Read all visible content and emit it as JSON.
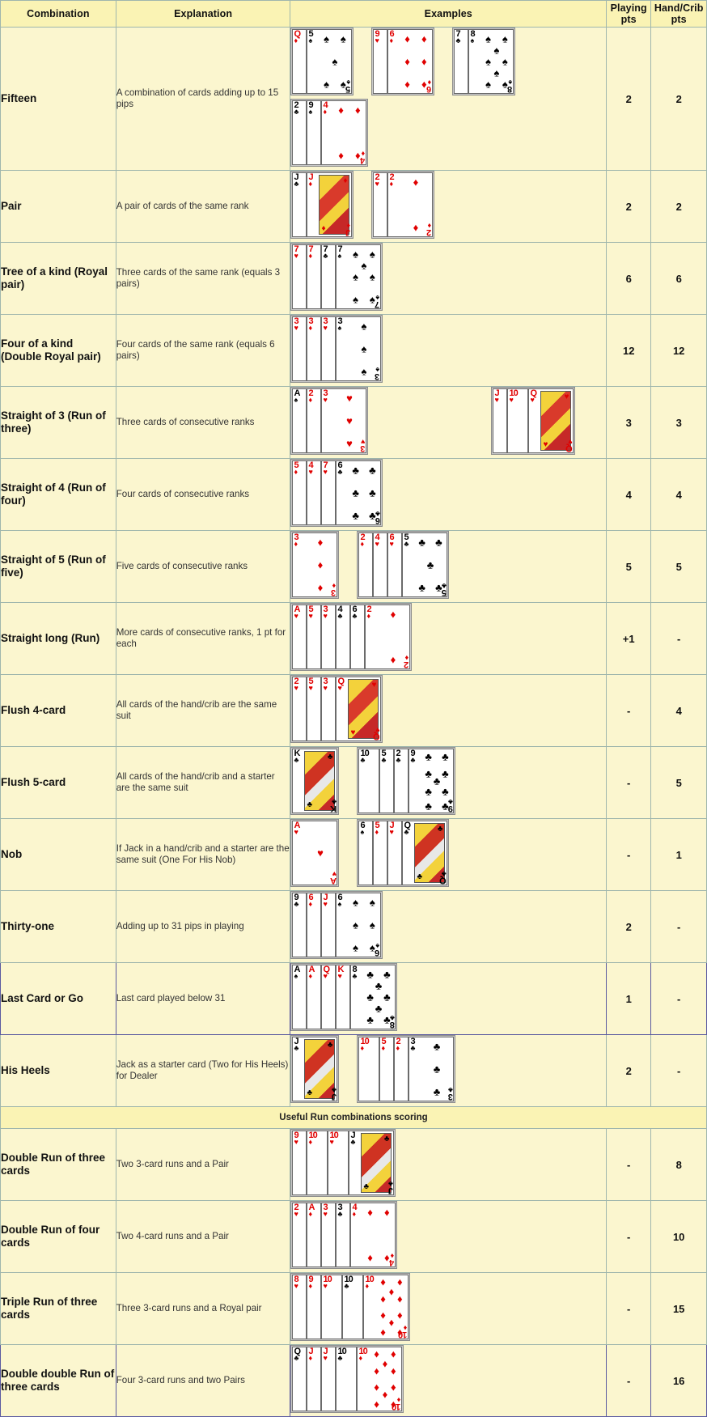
{
  "table": {
    "columns": [
      "Combination",
      "Explanation",
      "Examples",
      "Playing pts",
      "Hand/Crib pts"
    ],
    "headers": {
      "combination": "Combination",
      "explanation": "Explanation",
      "examples": "Examples",
      "playing_line1": "Playing",
      "playing_line2": "pts",
      "hand_line1": "Hand/Crib",
      "hand_line2": "pts"
    },
    "section_label": "Useful Run combinations scoring",
    "rows": [
      {
        "combination": "Fifteen",
        "explanation": "A combination of cards adding up to 15 pips",
        "playing_pts": "2",
        "hand_pts": "2",
        "hands": [
          {
            "cards": [
              {
                "rank": "Q",
                "suit": "diamonds",
                "color": "red",
                "face": true
              },
              {
                "rank": "5",
                "suit": "spades",
                "color": "black",
                "full": true
              }
            ]
          },
          {
            "cards": [
              {
                "rank": "9",
                "suit": "hearts",
                "color": "red"
              },
              {
                "rank": "6",
                "suit": "diamonds",
                "color": "red",
                "full": true
              }
            ]
          },
          {
            "cards": [
              {
                "rank": "7",
                "suit": "clubs",
                "color": "black"
              },
              {
                "rank": "8",
                "suit": "spades",
                "color": "black",
                "full": true
              }
            ]
          },
          {
            "cards": [
              {
                "rank": "2",
                "suit": "clubs",
                "color": "black"
              },
              {
                "rank": "9",
                "suit": "spades",
                "color": "black"
              },
              {
                "rank": "4",
                "suit": "diamonds",
                "color": "red",
                "full": true
              }
            ],
            "newline": true
          }
        ]
      },
      {
        "combination": "Pair",
        "explanation": "A pair of cards of the same rank",
        "playing_pts": "2",
        "hand_pts": "2",
        "hands": [
          {
            "cards": [
              {
                "rank": "J",
                "suit": "clubs",
                "color": "black",
                "face": true
              },
              {
                "rank": "J",
                "suit": "diamonds",
                "color": "red",
                "face": true,
                "full": true
              }
            ]
          },
          {
            "cards": [
              {
                "rank": "2",
                "suit": "hearts",
                "color": "red"
              },
              {
                "rank": "2",
                "suit": "diamonds",
                "color": "red",
                "full": true
              }
            ]
          }
        ]
      },
      {
        "combination": "Tree of a kind (Royal pair)",
        "explanation": "Three cards of the same rank (equals 3 pairs)",
        "playing_pts": "6",
        "hand_pts": "6",
        "hands": [
          {
            "cards": [
              {
                "rank": "7",
                "suit": "hearts",
                "color": "red"
              },
              {
                "rank": "7",
                "suit": "diamonds",
                "color": "red"
              },
              {
                "rank": "7",
                "suit": "clubs",
                "color": "black"
              },
              {
                "rank": "7",
                "suit": "spades",
                "color": "black",
                "full": true
              }
            ]
          }
        ]
      },
      {
        "combination": "Four of a kind (Double Royal pair)",
        "explanation": "Four cards of the same rank (equals 6 pairs)",
        "playing_pts": "12",
        "hand_pts": "12",
        "hands": [
          {
            "cards": [
              {
                "rank": "3",
                "suit": "hearts",
                "color": "red"
              },
              {
                "rank": "3",
                "suit": "diamonds",
                "color": "red"
              },
              {
                "rank": "3",
                "suit": "hearts",
                "color": "red"
              },
              {
                "rank": "3",
                "suit": "spades",
                "color": "black",
                "full": true
              }
            ]
          }
        ]
      },
      {
        "combination": "Straight of 3 (Run of three)",
        "explanation": "Three cards of consecutive ranks",
        "playing_pts": "3",
        "hand_pts": "3",
        "hands": [
          {
            "cards": [
              {
                "rank": "A",
                "suit": "spades",
                "color": "black"
              },
              {
                "rank": "2",
                "suit": "diamonds",
                "color": "red"
              },
              {
                "rank": "3",
                "suit": "hearts",
                "color": "red",
                "full": true
              }
            ]
          },
          {
            "cards": [
              {
                "rank": "J",
                "suit": "hearts",
                "color": "red",
                "face": true
              },
              {
                "rank": "10",
                "suit": "hearts",
                "color": "red"
              },
              {
                "rank": "Q",
                "suit": "hearts",
                "color": "red",
                "face": true,
                "full": true
              }
            ],
            "indent": true
          }
        ]
      },
      {
        "combination": "Straight of 4 (Run of four)",
        "explanation": "Four cards of consecutive ranks",
        "playing_pts": "4",
        "hand_pts": "4",
        "hands": [
          {
            "cards": [
              {
                "rank": "5",
                "suit": "diamonds",
                "color": "red"
              },
              {
                "rank": "4",
                "suit": "hearts",
                "color": "red"
              },
              {
                "rank": "7",
                "suit": "hearts",
                "color": "red"
              },
              {
                "rank": "6",
                "suit": "clubs",
                "color": "black",
                "full": true
              }
            ]
          }
        ]
      },
      {
        "combination": "Straight of 5 (Run of five)",
        "explanation": "Five cards of consecutive ranks",
        "playing_pts": "5",
        "hand_pts": "5",
        "hands": [
          {
            "cards": [
              {
                "rank": "3",
                "suit": "diamonds",
                "color": "red",
                "full": true
              }
            ]
          },
          {
            "cards": [
              {
                "rank": "2",
                "suit": "diamonds",
                "color": "red"
              },
              {
                "rank": "4",
                "suit": "hearts",
                "color": "red"
              },
              {
                "rank": "6",
                "suit": "hearts",
                "color": "red"
              },
              {
                "rank": "5",
                "suit": "clubs",
                "color": "black",
                "full": true
              }
            ]
          }
        ]
      },
      {
        "combination": "Straight long (Run)",
        "explanation": "More cards of consecutive ranks, 1 pt for each",
        "playing_pts": "+1",
        "hand_pts": "-",
        "hands": [
          {
            "cards": [
              {
                "rank": "A",
                "suit": "hearts",
                "color": "red"
              },
              {
                "rank": "5",
                "suit": "hearts",
                "color": "red"
              },
              {
                "rank": "3",
                "suit": "hearts",
                "color": "red"
              },
              {
                "rank": "4",
                "suit": "clubs",
                "color": "black"
              },
              {
                "rank": "6",
                "suit": "clubs",
                "color": "black"
              },
              {
                "rank": "2",
                "suit": "diamonds",
                "color": "red",
                "full": true
              }
            ]
          }
        ]
      },
      {
        "combination": "Flush 4-card",
        "explanation": "All cards of the hand/crib are the same suit",
        "playing_pts": "-",
        "hand_pts": "4",
        "hands": [
          {
            "cards": [
              {
                "rank": "2",
                "suit": "hearts",
                "color": "red"
              },
              {
                "rank": "5",
                "suit": "hearts",
                "color": "red"
              },
              {
                "rank": "3",
                "suit": "hearts",
                "color": "red"
              },
              {
                "rank": "Q",
                "suit": "hearts",
                "color": "red",
                "face": true,
                "full": true
              }
            ]
          }
        ]
      },
      {
        "combination": "Flush 5-card",
        "explanation": "All cards of the hand/crib and a starter are the same suit",
        "playing_pts": "-",
        "hand_pts": "5",
        "hands": [
          {
            "cards": [
              {
                "rank": "K",
                "suit": "clubs",
                "color": "black",
                "face": true,
                "full": true
              }
            ]
          },
          {
            "cards": [
              {
                "rank": "10",
                "suit": "clubs",
                "color": "black"
              },
              {
                "rank": "5",
                "suit": "clubs",
                "color": "black"
              },
              {
                "rank": "2",
                "suit": "clubs",
                "color": "black"
              },
              {
                "rank": "9",
                "suit": "clubs",
                "color": "black",
                "full": true
              }
            ]
          }
        ]
      },
      {
        "combination": "Nob",
        "explanation": "If Jack in a hand/crib and a starter are the same suit (One For His Nob)",
        "playing_pts": "-",
        "hand_pts": "1",
        "hands": [
          {
            "cards": [
              {
                "rank": "A",
                "suit": "hearts",
                "color": "red",
                "full": true
              }
            ]
          },
          {
            "cards": [
              {
                "rank": "6",
                "suit": "spades",
                "color": "black"
              },
              {
                "rank": "5",
                "suit": "diamonds",
                "color": "red"
              },
              {
                "rank": "J",
                "suit": "hearts",
                "color": "red",
                "face": true
              },
              {
                "rank": "Q",
                "suit": "clubs",
                "color": "black",
                "face": true,
                "full": true
              }
            ]
          }
        ]
      },
      {
        "combination": "Thirty-one",
        "explanation": "Adding up to 31 pips in playing",
        "playing_pts": "2",
        "hand_pts": "-",
        "hands": [
          {
            "cards": [
              {
                "rank": "9",
                "suit": "clubs",
                "color": "black"
              },
              {
                "rank": "6",
                "suit": "diamonds",
                "color": "red"
              },
              {
                "rank": "J",
                "suit": "hearts",
                "color": "red",
                "face": true
              },
              {
                "rank": "6",
                "suit": "spades",
                "color": "black",
                "full": true
              }
            ]
          }
        ]
      },
      {
        "combination": "Last Card or Go",
        "explanation": "Last card played below 31",
        "playing_pts": "1",
        "hand_pts": "-",
        "highlight": true,
        "hands": [
          {
            "cards": [
              {
                "rank": "A",
                "suit": "spades",
                "color": "black"
              },
              {
                "rank": "A",
                "suit": "diamonds",
                "color": "red"
              },
              {
                "rank": "Q",
                "suit": "hearts",
                "color": "red",
                "face": true
              },
              {
                "rank": "K",
                "suit": "hearts",
                "color": "red",
                "face": true
              },
              {
                "rank": "8",
                "suit": "clubs",
                "color": "black",
                "full": true
              }
            ]
          }
        ]
      },
      {
        "combination": "His Heels",
        "explanation": "Jack as a starter card (Two for His Heels) for Dealer",
        "playing_pts": "2",
        "hand_pts": "-",
        "hands": [
          {
            "cards": [
              {
                "rank": "J",
                "suit": "clubs",
                "color": "black",
                "face": true,
                "full": true
              }
            ]
          },
          {
            "cards": [
              {
                "rank": "10",
                "suit": "diamonds",
                "color": "red"
              },
              {
                "rank": "5",
                "suit": "diamonds",
                "color": "red"
              },
              {
                "rank": "2",
                "suit": "diamonds",
                "color": "red"
              },
              {
                "rank": "3",
                "suit": "clubs",
                "color": "black",
                "full": true
              }
            ]
          }
        ]
      },
      {
        "combination": "Double Run of three cards",
        "explanation": "Two 3-card runs and a Pair",
        "playing_pts": "-",
        "hand_pts": "8",
        "section": "useful",
        "hands": [
          {
            "cards": [
              {
                "rank": "9",
                "suit": "hearts",
                "color": "red"
              },
              {
                "rank": "10",
                "suit": "diamonds",
                "color": "red"
              },
              {
                "rank": "10",
                "suit": "hearts",
                "color": "red"
              },
              {
                "rank": "J",
                "suit": "clubs",
                "color": "black",
                "face": true,
                "full": true
              }
            ]
          }
        ]
      },
      {
        "combination": "Double Run of four cards",
        "explanation": "Two 4-card runs and a Pair",
        "playing_pts": "-",
        "hand_pts": "10",
        "section": "useful",
        "hands": [
          {
            "cards": [
              {
                "rank": "2",
                "suit": "hearts",
                "color": "red"
              },
              {
                "rank": "A",
                "suit": "diamonds",
                "color": "red"
              },
              {
                "rank": "3",
                "suit": "hearts",
                "color": "red"
              },
              {
                "rank": "3",
                "suit": "clubs",
                "color": "black"
              },
              {
                "rank": "4",
                "suit": "diamonds",
                "color": "red",
                "full": true
              }
            ]
          }
        ]
      },
      {
        "combination": "Triple Run of three cards",
        "explanation": "Three 3-card runs and a Royal pair",
        "playing_pts": "-",
        "hand_pts": "15",
        "section": "useful",
        "hands": [
          {
            "cards": [
              {
                "rank": "8",
                "suit": "hearts",
                "color": "red"
              },
              {
                "rank": "9",
                "suit": "diamonds",
                "color": "red"
              },
              {
                "rank": "10",
                "suit": "hearts",
                "color": "red"
              },
              {
                "rank": "10",
                "suit": "clubs",
                "color": "black"
              },
              {
                "rank": "10",
                "suit": "diamonds",
                "color": "red",
                "full": true
              }
            ]
          }
        ]
      },
      {
        "combination": "Double double Run of three cards",
        "explanation": "Four 3-card runs and two Pairs",
        "playing_pts": "-",
        "hand_pts": "16",
        "section": "useful",
        "highlight": true,
        "hands": [
          {
            "cards": [
              {
                "rank": "Q",
                "suit": "clubs",
                "color": "black",
                "face": true
              },
              {
                "rank": "J",
                "suit": "diamonds",
                "color": "red",
                "face": true
              },
              {
                "rank": "J",
                "suit": "hearts",
                "color": "red",
                "face": true
              },
              {
                "rank": "10",
                "suit": "clubs",
                "color": "black"
              },
              {
                "rank": "10",
                "suit": "diamonds",
                "color": "red",
                "full": true
              }
            ]
          }
        ]
      }
    ]
  },
  "colors": {
    "header_bg": "#faf3b4",
    "cell_bg": "#fbf6cf",
    "border": "#9fb6ad",
    "highlight_border": "#5a5aa0",
    "red_suit": "#e00000",
    "black_suit": "#000000"
  }
}
